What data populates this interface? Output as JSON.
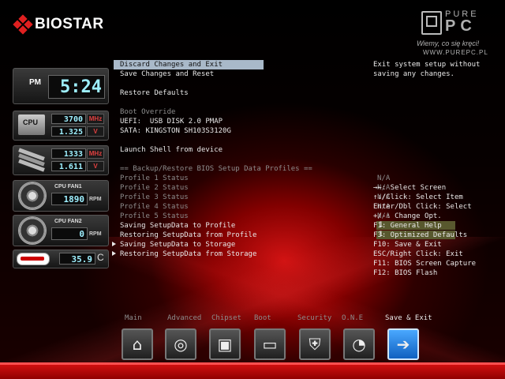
{
  "brand": {
    "name": "BIOSTAR"
  },
  "watermark": {
    "word1": "PURE",
    "word2": "PC",
    "tagline": "Wiemy, co się kręci!",
    "url": "WWW.PUREPC.PL"
  },
  "clock": {
    "ampm": "PM",
    "time": "5:24"
  },
  "hardware": {
    "cpu": {
      "label": "CPU",
      "freq": "3700",
      "freq_unit": "MHz",
      "voltage": "1.325",
      "voltage_unit": "V"
    },
    "memory": {
      "freq": "1333",
      "freq_unit": "MHz",
      "voltage": "1.611",
      "voltage_unit": "V"
    },
    "fan1": {
      "label": "CPU FAN1",
      "rpm": "1890",
      "unit": "RPM"
    },
    "fan2": {
      "label": "CPU FAN2",
      "rpm": "0",
      "unit": "RPM"
    },
    "temperature": {
      "value": "35.9",
      "unit": "C"
    }
  },
  "menu": {
    "items": [
      {
        "label": "Discard Changes and Exit"
      },
      {
        "label": "Save Changes and Reset"
      },
      {
        "label": "Restore Defaults"
      },
      {
        "label": "Boot Override"
      },
      {
        "label": "UEFI:  USB DISK 2.0 PMAP"
      },
      {
        "label": "SATA: KINGSTON SH103S3120G"
      },
      {
        "label": "Launch Shell from device"
      },
      {
        "label": "== Backup/Restore BIOS Setup Data Profiles =="
      },
      {
        "label": "Profile 1 Status",
        "value": "N/A"
      },
      {
        "label": "Profile 2 Status",
        "value": "N/A"
      },
      {
        "label": "Profile 3 Status",
        "value": "N/A"
      },
      {
        "label": "Profile 4 Status",
        "value": "N/A"
      },
      {
        "label": "Profile 5 Status",
        "value": "N/A"
      },
      {
        "label": "Saving SetupData to Profile",
        "value": "1"
      },
      {
        "label": "Restoring SetupData from Profile",
        "value": "1"
      },
      {
        "label": "Saving SetupData to Storage"
      },
      {
        "label": "Restoring SetupData from Storage"
      }
    ]
  },
  "help": {
    "description": "Exit system setup without\nsaving any changes.",
    "keys": [
      "→←: Select Screen",
      "↑↓/Click: Select Item",
      "Enter/Dbl Click: Select",
      "+/-: Change Opt.",
      "F1: General Help",
      "F3: Optimized Defaults",
      "F10: Save & Exit",
      "ESC/Right Click: Exit",
      "F11: BIOS Screen Capture",
      "F12: BIOS Flash"
    ]
  },
  "tabs": [
    {
      "label": "Main",
      "icon": "home-icon",
      "glyph": "⌂"
    },
    {
      "label": "Advanced",
      "icon": "disc-icon",
      "glyph": "◎"
    },
    {
      "label": "Chipset",
      "icon": "chip-icon",
      "glyph": "▣"
    },
    {
      "label": "Boot",
      "icon": "drive-icon",
      "glyph": "▭"
    },
    {
      "label": "Security",
      "icon": "shield-icon",
      "glyph": "⛨"
    },
    {
      "label": "O.N.E",
      "icon": "gauge-icon",
      "glyph": "◔"
    },
    {
      "label": "Save & Exit",
      "icon": "save-exit-icon",
      "glyph": "➔"
    }
  ],
  "colors": {
    "accent_red": "#d01010",
    "lcd_text": "#9ef0ff",
    "selected_bg": "#a9b9c9",
    "active_tab": "#1060c0"
  }
}
